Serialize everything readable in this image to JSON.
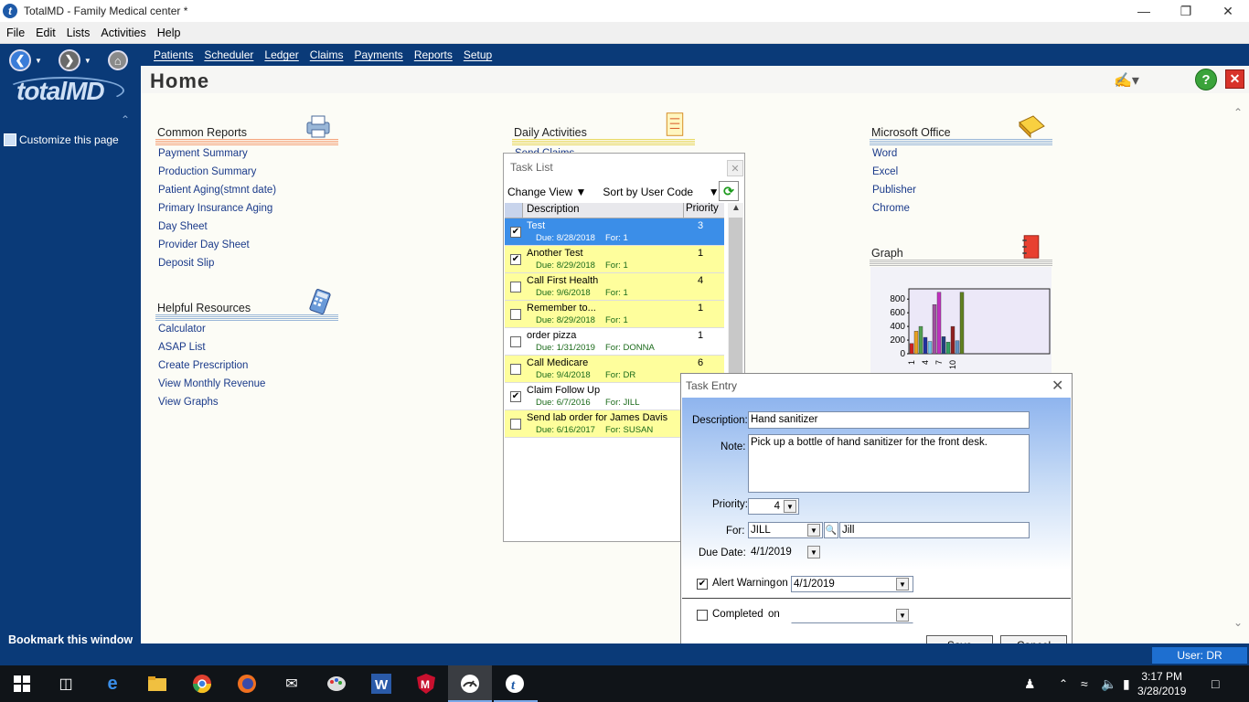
{
  "window": {
    "title": "TotalMD - Family Medical center *"
  },
  "menu": [
    "File",
    "Edit",
    "Lists",
    "Activities",
    "Help"
  ],
  "sidebar": {
    "logo_text": "totalMD",
    "customize_label": "Customize this page",
    "bookmark_label": "Bookmark this window"
  },
  "nav": [
    "Patients",
    "Scheduler",
    "Ledger",
    "Claims",
    "Payments",
    "Reports",
    "Setup"
  ],
  "page_title": "Home",
  "sections": {
    "common_reports": {
      "title": "Common Reports",
      "links": [
        "Payment Summary",
        "Production Summary",
        "Patient Aging(stmnt date)",
        "Primary Insurance Aging",
        "Day Sheet",
        "Provider Day Sheet",
        "Deposit Slip"
      ]
    },
    "helpful_resources": {
      "title": "Helpful Resources",
      "links": [
        "Calculator",
        "ASAP List",
        "Create Prescription",
        "View Monthly Revenue",
        "View Graphs"
      ]
    },
    "daily_activities": {
      "title": "Daily Activities",
      "links": [
        "Send Claims"
      ]
    },
    "microsoft_office": {
      "title": "Microsoft Office",
      "links": [
        "Word",
        "Excel",
        "Publisher",
        "Chrome"
      ]
    },
    "graph": {
      "title": "Graph"
    }
  },
  "chart_data": {
    "type": "bar",
    "title": "",
    "categories": [
      "1",
      "2",
      "3",
      "4",
      "5",
      "6",
      "7",
      "8",
      "9",
      "10",
      "11",
      "12",
      "13"
    ],
    "x_tick_labels": [
      "1",
      "4",
      "7",
      "10"
    ],
    "values": [
      150,
      330,
      400,
      240,
      180,
      720,
      900,
      250,
      170,
      400,
      190,
      900,
      0
    ],
    "colors": [
      "#d02020",
      "#e8a020",
      "#50a050",
      "#2030a0",
      "#70c0e8",
      "#a050a0",
      "#c030c0",
      "#204080",
      "#30a060",
      "#902020",
      "#6090c0",
      "#608020",
      "#cccccc"
    ],
    "yticks": [
      "0",
      "200",
      "400",
      "600",
      "800"
    ],
    "ylim": [
      0,
      950
    ],
    "grid": false
  },
  "task_list": {
    "title": "Task List",
    "change_view_label": "Change View",
    "sort_label": "Sort by User Code",
    "columns": [
      "Description",
      "Priority"
    ],
    "rows": [
      {
        "checked": true,
        "description": "Test",
        "due": "Due: 8/28/2018",
        "for": "For: 1",
        "priority": "3",
        "style": "selected"
      },
      {
        "checked": true,
        "description": "Another Test",
        "due": "Due: 8/29/2018",
        "for": "For: 1",
        "priority": "1",
        "style": "yellow"
      },
      {
        "checked": false,
        "description": "Call First Health",
        "due": "Due: 9/6/2018",
        "for": "For: 1",
        "priority": "4",
        "style": "yellow"
      },
      {
        "checked": false,
        "description": "Remember to...",
        "due": "Due: 8/29/2018",
        "for": "For: 1",
        "priority": "1",
        "style": "yellow"
      },
      {
        "checked": false,
        "description": "order pizza",
        "due": "Due: 1/31/2019",
        "for": "For: DONNA",
        "priority": "1",
        "style": "white"
      },
      {
        "checked": false,
        "description": "Call Medicare",
        "due": "Due: 9/4/2018",
        "for": "For: DR",
        "priority": "6",
        "style": "yellow"
      },
      {
        "checked": true,
        "description": "Claim Follow Up",
        "due": "Due: 6/7/2016",
        "for": "For: JILL",
        "priority": "",
        "style": "white"
      },
      {
        "checked": false,
        "description": "Send lab order for James Davis",
        "due": "Due: 6/16/2017",
        "for": "For: SUSAN",
        "priority": "",
        "style": "yellow"
      }
    ]
  },
  "task_entry": {
    "title": "Task Entry",
    "description_label": "Description:",
    "description_value": "Hand sanitizer",
    "note_label": "Note:",
    "note_value": "Pick up a bottle of hand sanitizer for the front desk.",
    "priority_label": "Priority:",
    "priority_value": "4",
    "for_label": "For:",
    "for_value": "JILL",
    "for_name": "Jill",
    "due_date_label": "Due Date:",
    "due_date_value": "4/1/2019",
    "alert_label": "Alert Warning",
    "alert_on_label": "on",
    "alert_checked": true,
    "alert_date": "4/1/2019",
    "completed_label": "Completed",
    "completed_on_label": "on",
    "completed_checked": false,
    "completed_date": "",
    "save_label": "Save",
    "cancel_label": "Cancel"
  },
  "status": {
    "user": "User: DR"
  },
  "taskbar": {
    "time": "3:17 PM",
    "date": "3/28/2019"
  }
}
